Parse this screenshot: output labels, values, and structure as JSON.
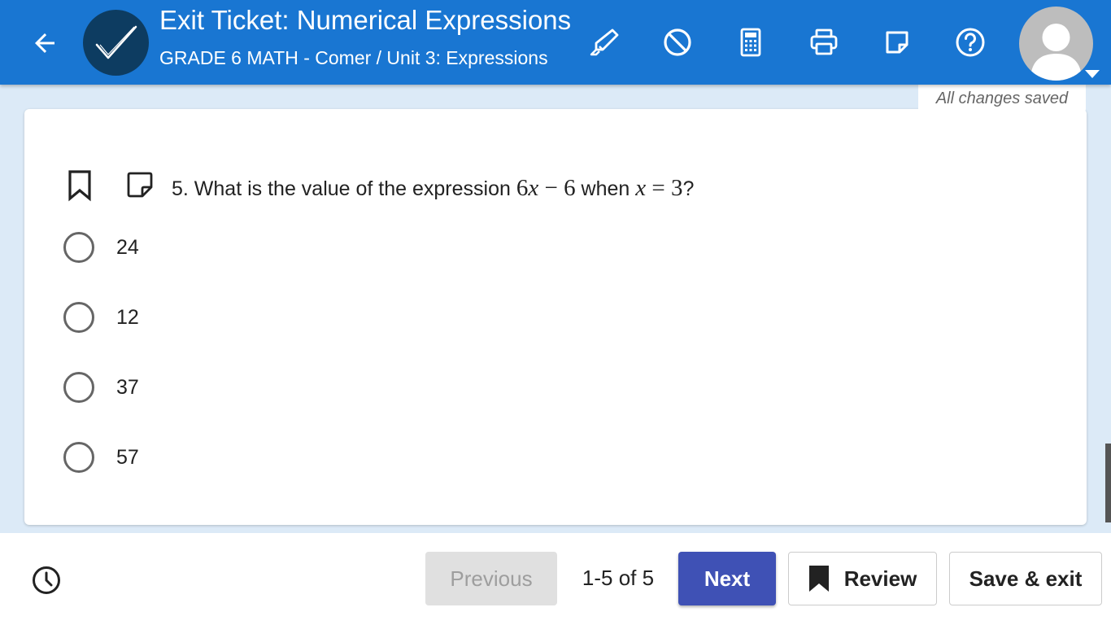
{
  "header": {
    "title": "Exit Ticket: Numerical Expressions",
    "subtitle": "GRADE 6 MATH - Comer / Unit 3: Expressions",
    "tools": [
      "highlighter-icon",
      "no-symbol-icon",
      "calculator-icon",
      "printer-icon",
      "sticky-note-icon",
      "help-icon"
    ],
    "color": "#1976d2"
  },
  "status": {
    "saved": "All changes saved"
  },
  "question": {
    "prefix": "5. What is the value of the expression",
    "expr_coef": "6",
    "expr_var": "x",
    "expr_minus": "−",
    "expr_const": "6",
    "when": "when",
    "cond_var": "x",
    "cond_eq": "=",
    "cond_val": "3",
    "suffix": "?",
    "options": [
      "24",
      "12",
      "37",
      "57"
    ]
  },
  "footer": {
    "previous": "Previous",
    "page_count": "1-5 of 5",
    "next": "Next",
    "review": "Review",
    "save_exit": "Save & exit"
  },
  "colors": {
    "next_button": "#3f51b5",
    "background": "#dceaf7"
  }
}
